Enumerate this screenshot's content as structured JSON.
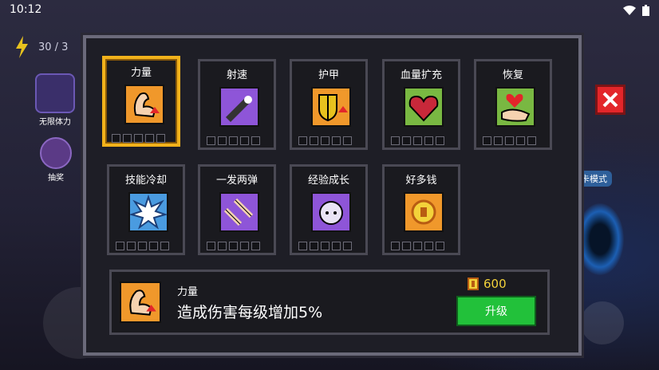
{
  "status_bar": {
    "time": "10:12"
  },
  "hud": {
    "energy_text": "30 / 3",
    "left_items": [
      {
        "label": "无限体力",
        "icon": "energy-video-icon"
      },
      {
        "label": "抽奖",
        "icon": "lottery-icon"
      }
    ],
    "side_tag": "卡模式"
  },
  "skills": [
    {
      "name": "力量",
      "icon": "strength-arm-icon",
      "levels": 5,
      "selected": true,
      "color": "#f0982b"
    },
    {
      "name": "射速",
      "icon": "bullet-speed-icon",
      "levels": 5,
      "selected": false,
      "color": "#8e55d8"
    },
    {
      "name": "护甲",
      "icon": "armor-shield-icon",
      "levels": 5,
      "selected": false,
      "color": "#f0982b"
    },
    {
      "name": "血量扩充",
      "icon": "heart-expand-icon",
      "levels": 5,
      "selected": false,
      "color": "#79b842"
    },
    {
      "name": "恢复",
      "icon": "heal-hand-heart-icon",
      "levels": 5,
      "selected": false,
      "color": "#79b842"
    },
    {
      "name": "技能冷却",
      "icon": "cooldown-spike-icon",
      "levels": 5,
      "selected": false,
      "color": "#4a9be0"
    },
    {
      "name": "一发两弹",
      "icon": "double-bullet-icon",
      "levels": 5,
      "selected": false,
      "color": "#8e55d8"
    },
    {
      "name": "经验成长",
      "icon": "exp-growth-icon",
      "levels": 5,
      "selected": false,
      "color": "#8e55d8"
    },
    {
      "name": "好多钱",
      "icon": "lots-of-money-icon",
      "levels": 5,
      "selected": false,
      "color": "#f0982b"
    }
  ],
  "detail": {
    "name": "力量",
    "description": "造成伤害每级增加5%",
    "cost": "600",
    "upgrade_label": "升级"
  }
}
